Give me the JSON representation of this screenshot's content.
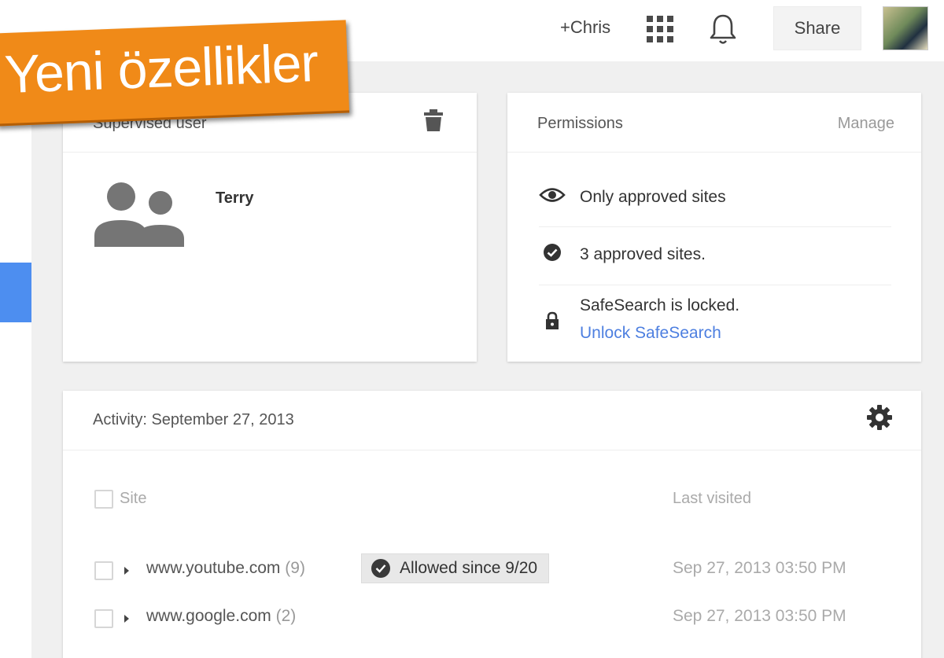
{
  "header": {
    "user_link": "+Chris",
    "apps_icon": "apps-grid-icon",
    "notifications_icon": "bell-icon",
    "share_label": "Share",
    "avatar_icon": "profile-photo"
  },
  "banner": {
    "text": "Yeni özellikler",
    "color": "#f08a18"
  },
  "supervised_user": {
    "title": "Supervised user",
    "delete_icon": "trash-icon",
    "avatar_icon": "people-icon",
    "name": "Terry"
  },
  "permissions": {
    "title": "Permissions",
    "manage_label": "Manage",
    "items": [
      {
        "icon": "eye-icon",
        "text": "Only approved sites"
      },
      {
        "icon": "check-circle-icon",
        "text": "3 approved sites."
      },
      {
        "icon": "lock-icon",
        "text": "SafeSearch is locked.",
        "link": "Unlock SafeSearch"
      }
    ]
  },
  "activity": {
    "title": "Activity: September 27, 2013",
    "settings_icon": "gear-icon",
    "columns": {
      "site": "Site",
      "last_visited": "Last visited"
    },
    "rows": [
      {
        "url": "www.youtube.com",
        "count": "(9)",
        "badge": "Allowed since 9/20",
        "last_visited": "Sep 27, 2013 03:50 PM"
      },
      {
        "url": "www.google.com",
        "count": "(2)",
        "badge": "",
        "last_visited": "Sep 27, 2013 03:50 PM"
      }
    ]
  },
  "colors": {
    "accent_blue": "#4d8ef0",
    "link_blue": "#4d7fe0",
    "banner_orange": "#f08a18",
    "background": "#f0f0f0"
  }
}
